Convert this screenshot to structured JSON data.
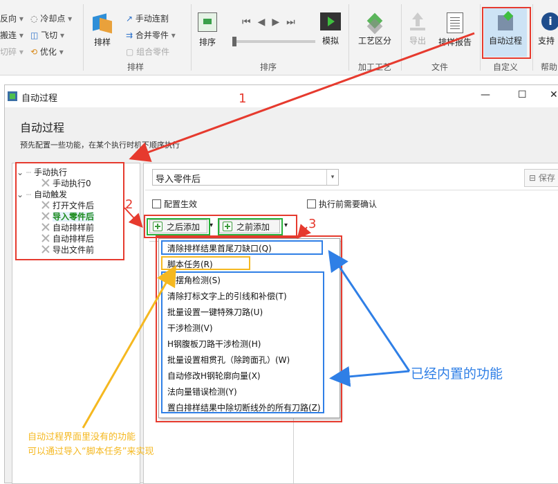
{
  "ribbon": {
    "left_items": [
      "反向",
      "搬连",
      "切碎"
    ],
    "group1_items": [
      "冷却点",
      "飞切",
      "优化"
    ],
    "nest_button": "排样",
    "manual_nest": "手动连割",
    "merge_parts": "合并零件",
    "group_parts": "组合零件",
    "group_label_nest": "排样",
    "sort_button": "排序",
    "simulate_button": "模拟",
    "group_label_sort": "排序",
    "craft_button": "工艺区分",
    "group_label_craft": "加工工艺",
    "export_button": "导出",
    "report_button": "排样报告",
    "group_label_file": "文件",
    "auto_process_button": "自动过程",
    "group_label_custom": "自定义",
    "support_button": "支持",
    "group_label_help": "帮助"
  },
  "dialog": {
    "title": "自动过程",
    "heading": "自动过程",
    "description": "预先配置一些功能，在某个执行时机下顺序执行",
    "tree": {
      "manual_group": "手动执行",
      "manual_child": "手动执行0",
      "auto_group": "自动触发",
      "auto_children": [
        "打开文件后",
        "导入零件后",
        "自动排样前",
        "自动排样后",
        "导出文件前"
      ]
    },
    "selected_trigger": "导入零件后",
    "save_label": "保存",
    "enable_config": "配置生效",
    "confirm_before": "执行前需要确认",
    "add_after": "之后添加",
    "add_before": "之前添加",
    "menu_items": [
      "清除排样结果首尾刀缺口(Q)",
      "脚本任务(R)",
      "超摆角检测(S)",
      "清除打标文字上的引线和补偿(T)",
      "批量设置一键特殊刀路(U)",
      "干涉检测(V)",
      "H钢腹板刀路干涉检测(H)",
      "批量设置相贯孔（除跨面孔）(W)",
      "自动修改H钢轮廓向量(X)",
      "法向量错误检测(Y)",
      "置白排样结果中除切断线外的所有刀路(Z)"
    ]
  },
  "annotations": {
    "num1": "1",
    "num2": "2",
    "num3": "3",
    "builtin_note": "已经内置的功能",
    "script_note_line1": "自动过程界面里没有的功能",
    "script_note_line2": "可以通过导入“脚本任务”来实现"
  },
  "colors": {
    "red": "#e63a2e",
    "blue": "#2f7fe6",
    "green": "#27b03a",
    "orange": "#f5b820",
    "selected_tree_text": "#1a8a1a"
  }
}
